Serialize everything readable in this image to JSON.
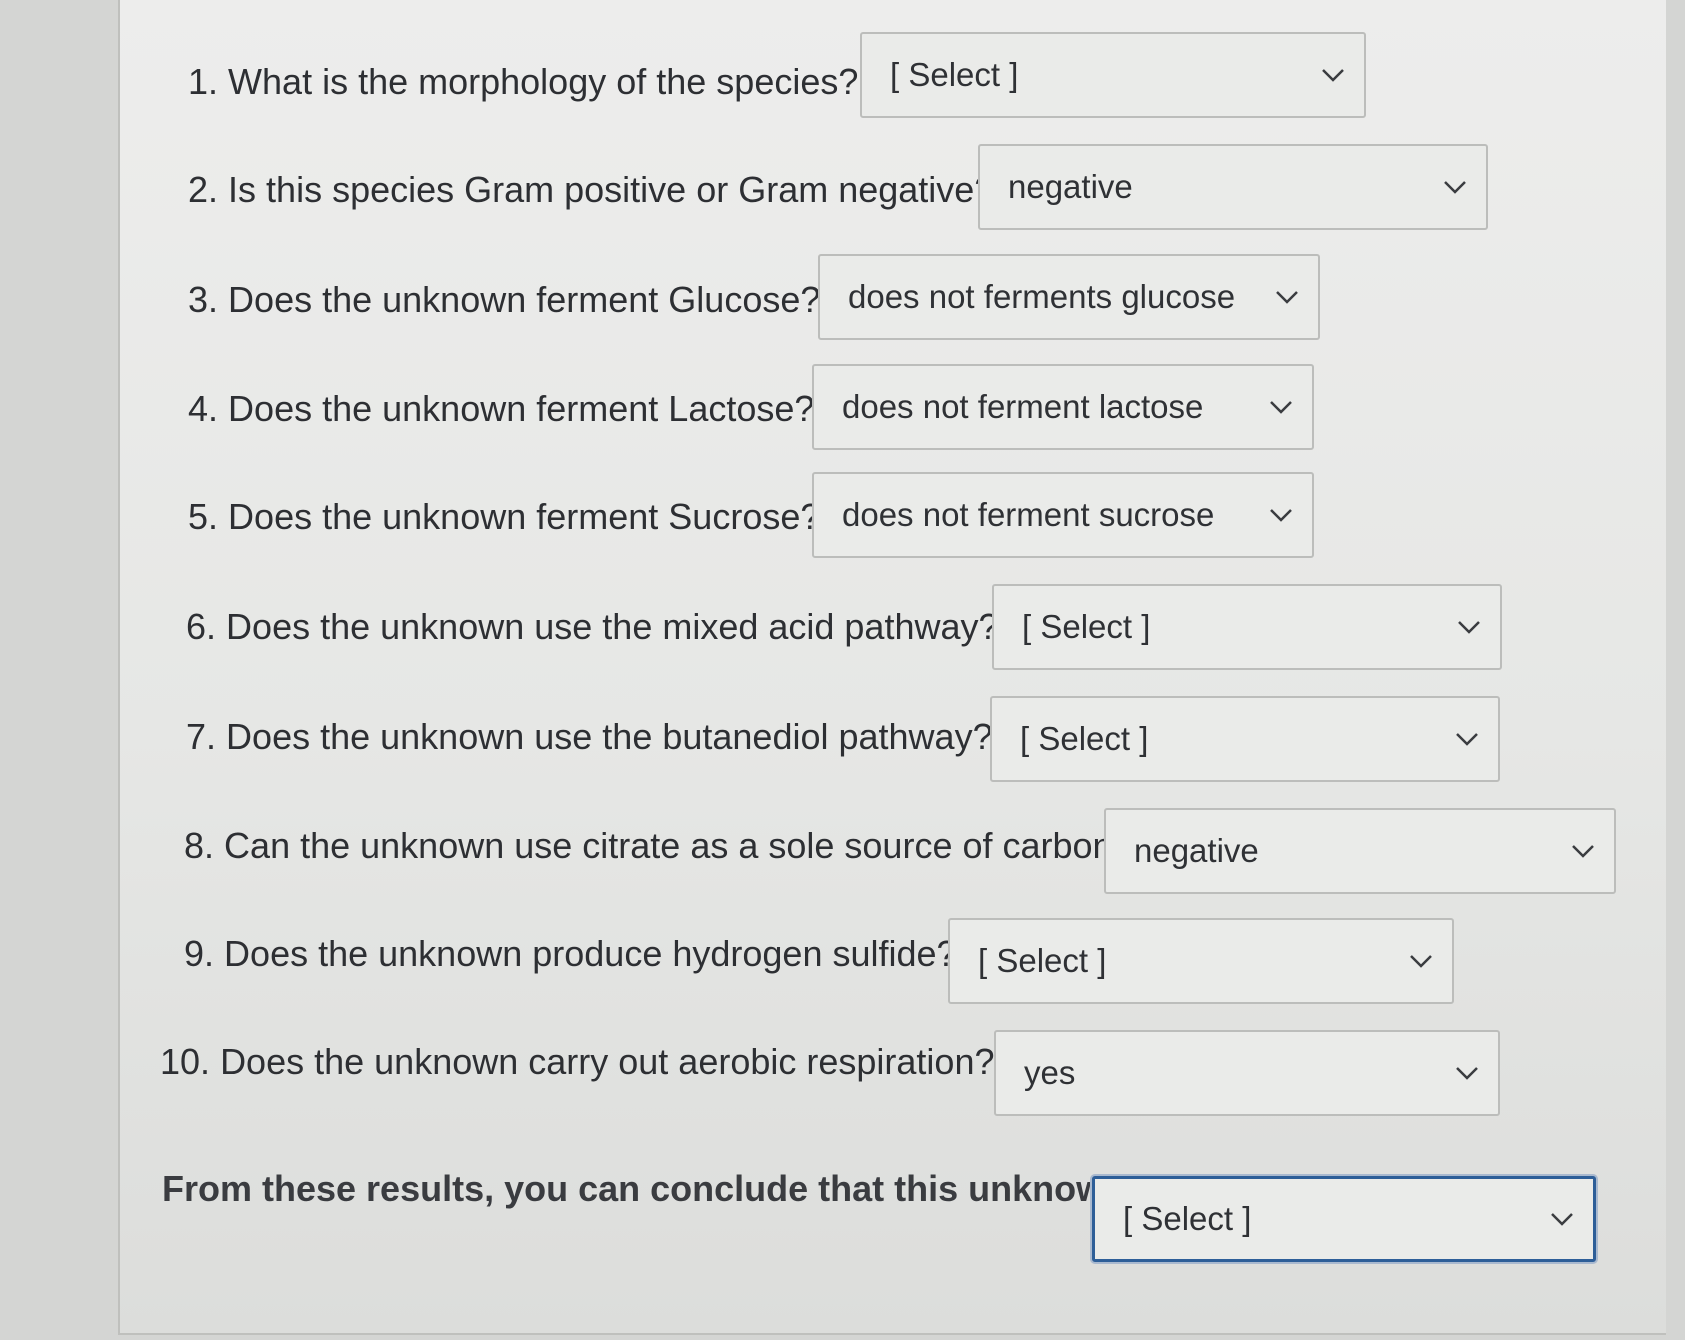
{
  "questions": [
    {
      "number": "1.",
      "text": "What is the morphology of the species?",
      "value": "[ Select ]"
    },
    {
      "number": "2.",
      "text": "Is this species Gram positive or Gram negative?",
      "value": "negative"
    },
    {
      "number": "3.",
      "text": "Does the unknown ferment Glucose?",
      "value": "does not ferments glucose"
    },
    {
      "number": "4.",
      "text": "Does the unknown ferment Lactose?",
      "value": "does not ferment lactose"
    },
    {
      "number": "5.",
      "text": "Does the unknown ferment Sucrose?",
      "value": "does not ferment sucrose"
    },
    {
      "number": "6.",
      "text": "Does the unknown use the mixed acid pathway?",
      "value": "[ Select ]"
    },
    {
      "number": "7.",
      "text": "Does the unknown use the butanediol pathway?",
      "value": "[ Select ]"
    },
    {
      "number": "8.",
      "text": "Can the unknown use citrate as a sole source of carbon?",
      "value": "negative"
    },
    {
      "number": "9.",
      "text": "Does the unknown produce hydrogen sulfide?",
      "value": "[ Select ]"
    },
    {
      "number": "10.",
      "text": "Does the unknown carry out aerobic respiration?",
      "value": "yes"
    }
  ],
  "conclusion": {
    "text": "From these results, you can conclude that this unknown is",
    "value": "[ Select ]"
  },
  "icons": {
    "dropdown": "chevron-down-icon"
  },
  "colors": {
    "focus_border": "#2d5e98",
    "text": "#2d2f33",
    "background": "#ededec"
  }
}
